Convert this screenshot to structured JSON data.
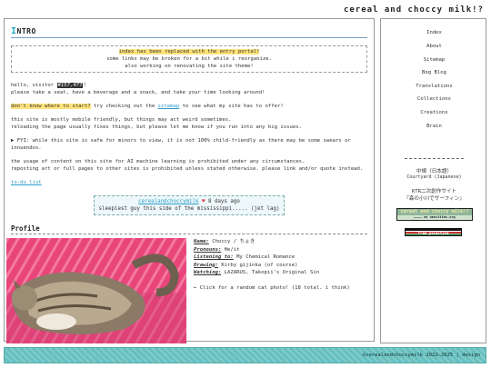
{
  "site": {
    "title": "cereal and choccy milk!?"
  },
  "intro": {
    "heading_first": "I",
    "heading_rest": "NTRO",
    "notice": {
      "line1": "index has been replaced with the entry portal!",
      "line2": "some links may be broken for a bit while i reorganize.",
      "line3": "also working on renovating the site theme!"
    },
    "hello_prefix": "hello, visitor ",
    "visitor_num": "#157,477",
    "hello_suffix": "!",
    "welcome": "please take a seat, have a beverage and a snack, and take your time looking around!",
    "dont_know": "don't know where to start?",
    "try_text": " try checking out the ",
    "sitemap_link": "sitemap",
    "after_sitemap": " to see what my site has to offer!",
    "mobile1": "this site is mostly mobile friendly, but things may act weird sometimes.",
    "mobile2": "reloading the page usually fixes things, but please let me know if you run into any big issues.",
    "fyi": "▶ FYI: while this site is safe for minors to view, it is not 100% child-friendly as there may be some swears or innuendos.",
    "ai": "the usage of content on this site for AI machine learning is prohibited under any circumstances.",
    "repost": "reposting art or full pages to other sites is prohibited unless stated otherwise. please link and/or quote instead.",
    "todo": "to-do list"
  },
  "status": {
    "user": "cerealandchoccymilk",
    "heart": "♥",
    "time": " 8 days ago",
    "message": "sleepiest guy this side of the mississippi..... (jet lag)"
  },
  "profile": {
    "heading": "Profile",
    "name_label": "Name:",
    "name_value": " Choccy / ちょき",
    "pronouns_label": "Pronouns:",
    "pronouns_value": " He/it",
    "listening_label": "Listening to:",
    "listening_value": " My Chemical Romance",
    "drawing_label": "Drawing:",
    "drawing_value": " Kirby gijinka (of course)",
    "watching_label": "Watching:",
    "watching_value": " LAZARUS, Takopii's Original Sin",
    "cat_note": "← Click for a random cat photo! (18 total. i think)"
  },
  "nav": {
    "items": [
      "Index",
      "About",
      "Sitemap",
      "Bog Blog",
      "Translations",
      "Collections",
      "Creations",
      "Brain"
    ],
    "lang1": "中規（日本語）",
    "lang1_sub": "Courtyard (Japanese)",
    "lang2": "KTR二次創作サイト",
    "lang2_sub": "『森の小川でサーフィン』",
    "badge1": "cereal and choccy milk!?",
    "badge1_sub": "———— on neocities.org",
    "badge2": "free palestine"
  },
  "footer": {
    "text": "©cerealandchoccymilk 2022–2025 | design"
  },
  "colors": {
    "accent": "#27a9c6",
    "highlight": "#ffe27a",
    "footer": "#66c0c0"
  }
}
